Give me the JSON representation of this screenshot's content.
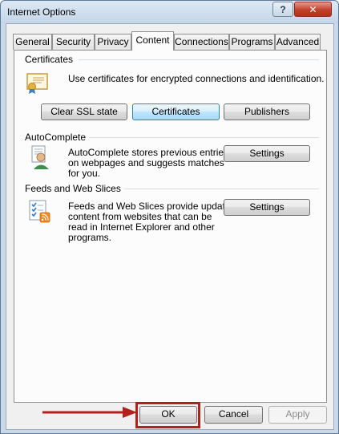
{
  "window": {
    "title": "Internet Options",
    "help_label": "?",
    "close_label": "✕"
  },
  "tabs": [
    {
      "label": "General",
      "active": false
    },
    {
      "label": "Security",
      "active": false
    },
    {
      "label": "Privacy",
      "active": false
    },
    {
      "label": "Content",
      "active": true
    },
    {
      "label": "Connections",
      "active": false
    },
    {
      "label": "Programs",
      "active": false
    },
    {
      "label": "Advanced",
      "active": false
    }
  ],
  "certificates": {
    "group_label": "Certificates",
    "description": "Use certificates for encrypted connections and identification.",
    "icon": "certificate-icon",
    "buttons": {
      "clear_ssl": "Clear SSL state",
      "certificates": "Certificates",
      "publishers": "Publishers"
    }
  },
  "autocomplete": {
    "group_label": "AutoComplete",
    "description_lines": [
      "AutoComplete stores previous entries",
      "on webpages and suggests matches",
      "for you."
    ],
    "icon": "autocomplete-user-icon",
    "settings_label": "Settings"
  },
  "feeds": {
    "group_label": "Feeds and Web Slices",
    "description_lines": [
      "Feeds and Web Slices provide updated",
      "content from websites that can be",
      "read in Internet Explorer and other",
      "programs."
    ],
    "icon": "feeds-checklist-icon",
    "settings_label": "Settings"
  },
  "footer": {
    "ok_label": "OK",
    "cancel_label": "Cancel",
    "apply_label": "Apply"
  },
  "colors": {
    "highlight": "#b3211c",
    "close_button": "#c3402b",
    "focus_border": "#3c7fb1"
  }
}
